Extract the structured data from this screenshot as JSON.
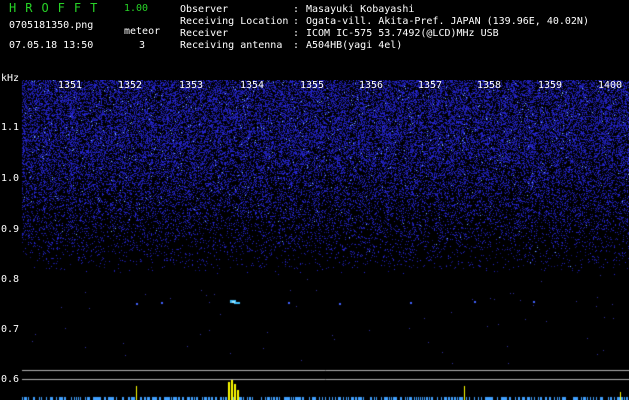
{
  "header": {
    "app_name": "HROFFT",
    "version": "1.00",
    "file_name": "0705181350.png",
    "datetime": "07.05.18 13:50",
    "meteor_label": "meteor",
    "meteor_count": "3",
    "info": [
      {
        "label": "Observer",
        "value": "Masayuki Kobayashi"
      },
      {
        "label": "Receiving Location",
        "value": "Ogata-vill. Akita-Pref. JAPAN (139.96E, 40.02N)"
      },
      {
        "label": "Receiver",
        "value": "ICOM IC-575 53.7492(@LCD)MHz USB"
      },
      {
        "label": "Receiving antenna",
        "value": "A504HB(yagi 4el)"
      }
    ],
    "colon": ":"
  },
  "plot": {
    "y_unit": "kHz",
    "y_ticks": [
      "1.1",
      "1.0",
      "0.9",
      "0.8",
      "0.7",
      "0.6"
    ],
    "x_ticks": [
      "1351",
      "1352",
      "1353",
      "1354",
      "1355",
      "1356",
      "1357",
      "1358",
      "1359",
      "1400"
    ],
    "colors": {
      "background": "#000000",
      "noise": "#3030d0",
      "echo": "#40c0ff",
      "peak": "#ffff00",
      "hline": "#c0c0c0"
    }
  }
}
